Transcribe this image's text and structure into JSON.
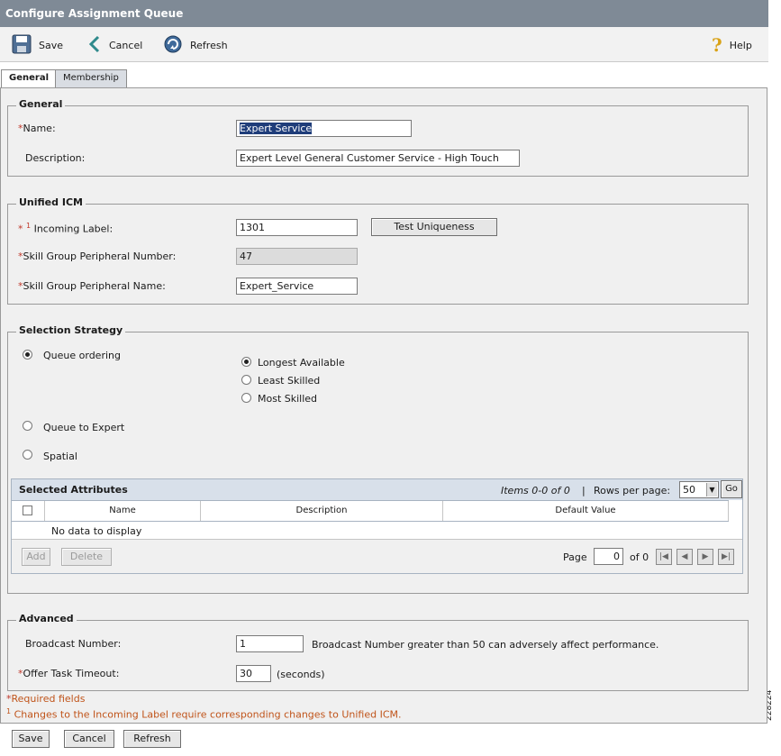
{
  "window": {
    "title": "Configure Assignment Queue"
  },
  "toolbar": {
    "save": "Save",
    "cancel": "Cancel",
    "refresh": "Refresh",
    "help": "Help"
  },
  "tabs": [
    {
      "label": "General"
    },
    {
      "label": "Membership"
    }
  ],
  "general": {
    "legend": "General",
    "name_label": "Name:",
    "name_value": "Expert Service",
    "description_label": "Description:",
    "description_value": "Expert Level General Customer Service - High Touch"
  },
  "icm": {
    "legend": "Unified ICM",
    "incoming_label": "Incoming Label:",
    "incoming_value": "1301",
    "footnote_marker": "1",
    "test_button": "Test Uniqueness",
    "peripheral_number_label": "Skill Group Peripheral Number:",
    "peripheral_number_value": "47",
    "peripheral_name_label": "Skill Group Peripheral Name:",
    "peripheral_name_value": "Expert_Service"
  },
  "strategy": {
    "legend": "Selection Strategy",
    "queue_ordering": "Queue ordering",
    "longest_available": "Longest Available",
    "least_skilled": "Least Skilled",
    "most_skilled": "Most Skilled",
    "queue_to_expert": "Queue to Expert",
    "spatial": "Spatial"
  },
  "attributes": {
    "title": "Selected Attributes",
    "items_info": "Items 0-0 of 0",
    "separator": "|",
    "rows_per_page_label": "Rows per page:",
    "rows_per_page_value": "50",
    "go": "Go",
    "col_name": "Name",
    "col_description": "Description",
    "col_default": "Default Value",
    "empty": "No data to display",
    "add": "Add",
    "delete": "Delete",
    "page_label": "Page",
    "page_value": "0",
    "of_label": "of 0"
  },
  "advanced": {
    "legend": "Advanced",
    "broadcast_label": "Broadcast Number:",
    "broadcast_value": "1",
    "broadcast_note": "Broadcast Number greater than 50 can adversely affect performance.",
    "timeout_label": "Offer Task Timeout:",
    "timeout_value": "30",
    "timeout_unit": "(seconds)"
  },
  "notes": {
    "required_marker": "*",
    "required": "Required fields",
    "footnote_marker": "1",
    "footnote": "Changes to the Incoming Label require corresponding changes to Unified ICM."
  },
  "bottom": {
    "save": "Save",
    "cancel": "Cancel",
    "refresh": "Refresh"
  },
  "side_id": "228224",
  "colors": {
    "titlebar": "#7f8a96",
    "required": "#c0392b",
    "note": "#c0541a",
    "grid_header": "#d8e0ea"
  }
}
